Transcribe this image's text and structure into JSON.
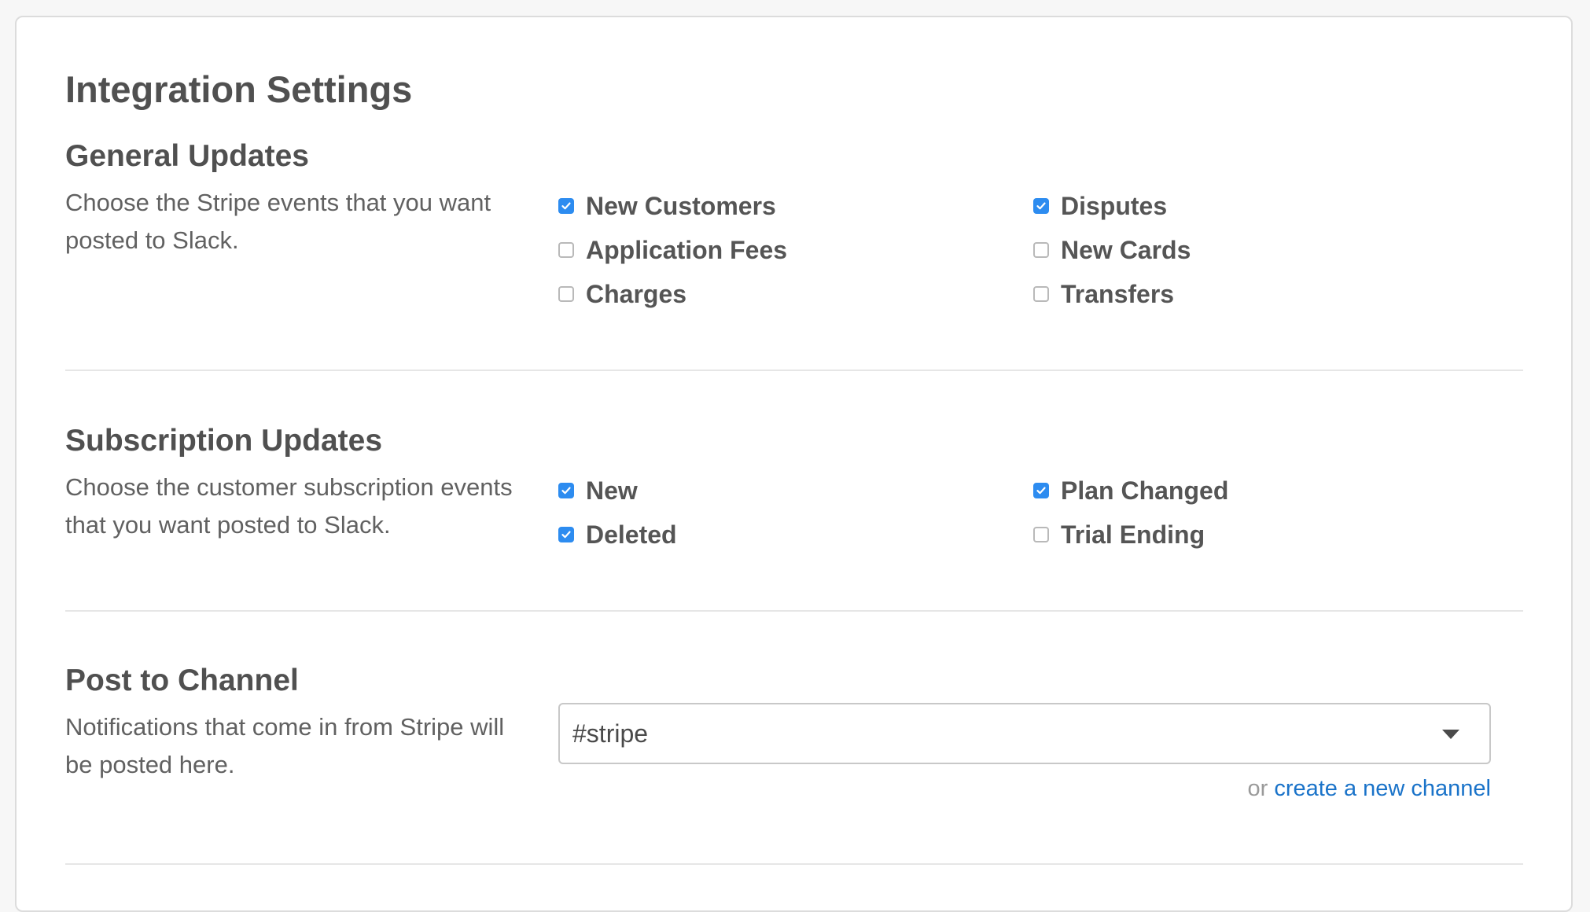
{
  "page_title": "Integration Settings",
  "general_updates": {
    "heading": "General Updates",
    "description": "Choose the Stripe events that you want posted to Slack.",
    "options": [
      {
        "label": "New Customers",
        "checked": true
      },
      {
        "label": "Application Fees",
        "checked": false
      },
      {
        "label": "Charges",
        "checked": false
      },
      {
        "label": "Disputes",
        "checked": true
      },
      {
        "label": "New Cards",
        "checked": false
      },
      {
        "label": "Transfers",
        "checked": false
      }
    ]
  },
  "subscription_updates": {
    "heading": "Subscription Updates",
    "description": "Choose the customer subscription events that you want posted to Slack.",
    "options": [
      {
        "label": "New",
        "checked": true
      },
      {
        "label": "Deleted",
        "checked": true
      },
      {
        "label": "Plan Changed",
        "checked": true
      },
      {
        "label": "Trial Ending",
        "checked": false
      }
    ]
  },
  "post_to_channel": {
    "heading": "Post to Channel",
    "description": "Notifications that come in from Stripe will be posted here.",
    "selected_channel": "#stripe",
    "or_text": "or",
    "create_link": "create a new channel"
  },
  "colors": {
    "checkbox_checked": "#2d8cf0",
    "link": "#1a73c9"
  }
}
